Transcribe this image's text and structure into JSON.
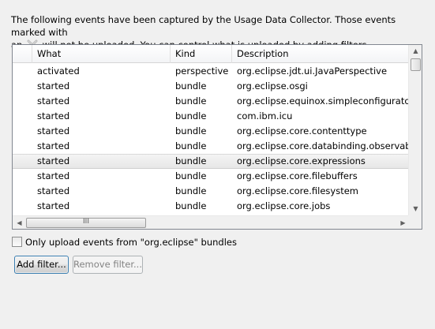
{
  "intro": {
    "line1": "The following events have been captured by the Usage Data Collector. Those events marked with",
    "line2_prefix": "an",
    "line2_suffix": "will not be uploaded. You can control what is uploaded by adding filters.",
    "icon": "x-mark-icon"
  },
  "table": {
    "headers": [
      "What",
      "Kind",
      "Description"
    ],
    "rows": [
      {
        "what": "activated",
        "kind": "perspective",
        "description": "org.eclipse.jdt.ui.JavaPerspective"
      },
      {
        "what": "started",
        "kind": "bundle",
        "description": "org.eclipse.osgi"
      },
      {
        "what": "started",
        "kind": "bundle",
        "description": "org.eclipse.equinox.simpleconfigurator"
      },
      {
        "what": "started",
        "kind": "bundle",
        "description": "com.ibm.icu"
      },
      {
        "what": "started",
        "kind": "bundle",
        "description": "org.eclipse.core.contenttype"
      },
      {
        "what": "started",
        "kind": "bundle",
        "description": "org.eclipse.core.databinding.observable"
      },
      {
        "what": "started",
        "kind": "bundle",
        "description": "org.eclipse.core.expressions"
      },
      {
        "what": "started",
        "kind": "bundle",
        "description": "org.eclipse.core.filebuffers"
      },
      {
        "what": "started",
        "kind": "bundle",
        "description": "org.eclipse.core.filesystem"
      },
      {
        "what": "started",
        "kind": "bundle",
        "description": "org.eclipse.core.jobs"
      }
    ],
    "selected_row": 6,
    "hscroll_thumb_label": "III"
  },
  "filter_checkbox": {
    "label": "Only upload events from \"org.eclipse\" bundles",
    "checked": false
  },
  "buttons": {
    "add_filter": "Add filter...",
    "remove_filter": "Remove filter..."
  }
}
